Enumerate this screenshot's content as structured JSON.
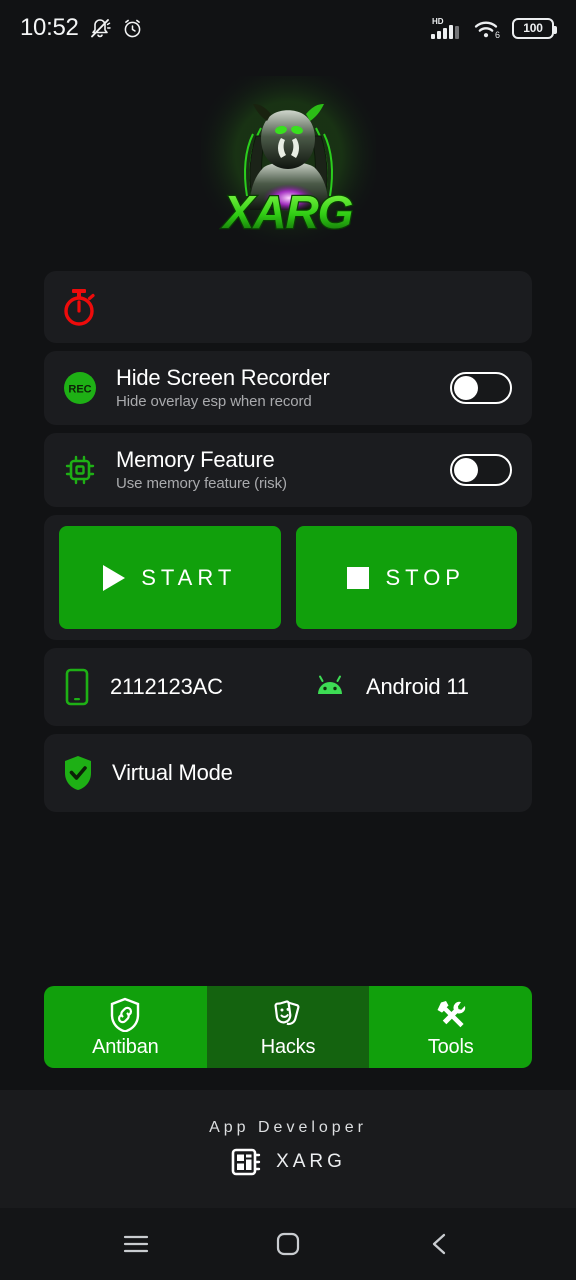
{
  "statusbar": {
    "time": "10:52",
    "icons_left": [
      "bell-slash-icon",
      "alarm-clock-icon"
    ],
    "network_label": "HD",
    "wifi_label": "6",
    "battery_level": "100"
  },
  "logo": {
    "brand_text": "XARG",
    "alt": "xarg-predator-logo",
    "glow_color": "#3fd62a",
    "accent_color": "#24b016"
  },
  "timer_card": {
    "icon": "stopwatch-icon",
    "icon_color": "#ee0b0b",
    "value": ""
  },
  "settings": [
    {
      "icon": "rec-badge-icon",
      "icon_text": "REC",
      "title": "Hide Screen Recorder",
      "subtitle": "Hide overlay esp when record",
      "enabled": false
    },
    {
      "icon": "memory-chip-icon",
      "title": "Memory Feature",
      "subtitle": "Use memory feature (risk)",
      "enabled": false
    }
  ],
  "actions": {
    "start_label": "START",
    "stop_label": "STOP",
    "start_icon": "play-icon",
    "stop_icon": "stop-square-icon",
    "button_color": "#11a00c"
  },
  "device": {
    "phone_icon": "smartphone-icon",
    "model": "2112123AC",
    "os_icon": "android-robot-icon",
    "os_version": "Android 11"
  },
  "virtual_mode": {
    "icon": "shield-check-icon",
    "label": "Virtual Mode"
  },
  "tabs": [
    {
      "icon": "shield-link-icon",
      "label": "Antiban",
      "active": true
    },
    {
      "icon": "theater-masks-icon",
      "label": "Hacks",
      "active": false
    },
    {
      "icon": "tools-icon",
      "label": "Tools",
      "active": true
    }
  ],
  "footer": {
    "title": "App Developer",
    "icon": "chip-grid-icon",
    "developer": "XARG"
  },
  "navbar": {
    "recents": "menu-icon",
    "home": "home-square-icon",
    "back": "back-chevron-icon"
  }
}
